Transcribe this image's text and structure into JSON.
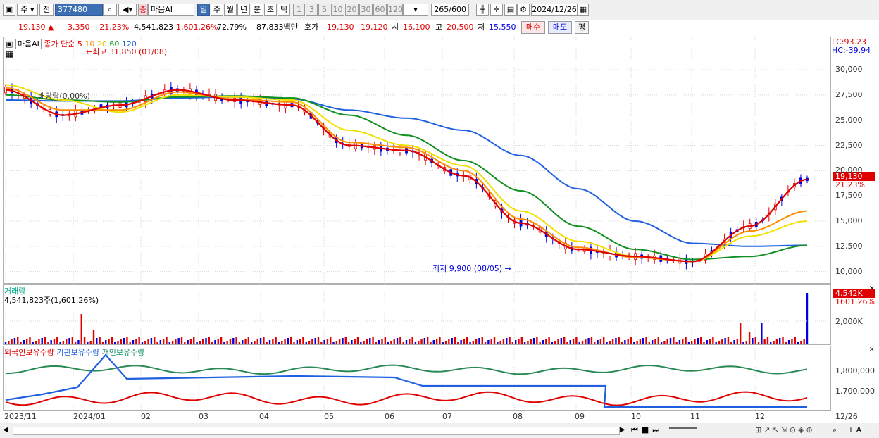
{
  "toolbar": {
    "market": "주",
    "type": "전",
    "code": "377480",
    "name": "마음AI",
    "periods": [
      "일",
      "주",
      "월",
      "년",
      "분",
      "초",
      "틱"
    ],
    "intervals": [
      "1",
      "3",
      "5",
      "10",
      "20",
      "30",
      "60",
      "120"
    ],
    "count": "265",
    "count_total": "/600",
    "date": "2024/12/26"
  },
  "info": {
    "price": "19,130 ▲",
    "change": "3,350",
    "change_pct": "+21.23%",
    "volume": "4,541,823",
    "volume_pct": "1,601.26%",
    "turnover": "72.79%",
    "amount": "87,833백만",
    "quote_label": "호가",
    "ask": "19,130",
    "bid": "19,120",
    "open_label": "시",
    "open": "16,100",
    "high_label": "고",
    "high": "20,500",
    "low_label": "저",
    "low": "15,550",
    "buy_label": "매수",
    "sell_label": "매도",
    "eval_label": "평"
  },
  "price_pane": {
    "name_tag": "마음AI",
    "ma_legend": {
      "prefix": "종가 단순",
      "periods": [
        "5",
        "10",
        "20",
        "60",
        "120"
      ]
    },
    "high_note": "←최고 31,850 (01/08)",
    "low_note": "최저 9,900 (08/05) →",
    "dividend_note": "배당락(0.00%)",
    "lc": "LC:93.23",
    "hc": "HC:-39.94",
    "current_price": "19,130",
    "current_pct": "21.23%"
  },
  "volume_pane": {
    "title": "거래량",
    "value": "4,541,823주(1,601.26%)",
    "current": "4,542K",
    "current_pct": "1601.26%",
    "tick": "2,000K"
  },
  "holding_pane": {
    "legend": [
      "외국인보유수량",
      "기관보유수량",
      "개인보유수량"
    ],
    "ticks": [
      "1,800,000",
      "1,700,000"
    ]
  },
  "x_axis": [
    "2023/11",
    "2024/01",
    "02",
    "03",
    "04",
    "05",
    "06",
    "07",
    "08",
    "09",
    "10",
    "11",
    "12",
    "12/26"
  ],
  "colors": {
    "ma5": "#e00000",
    "ma10": "#ff8c00",
    "ma20": "#f0e000",
    "ma60": "#109020",
    "ma120": "#2060e0",
    "up": "#e00000",
    "down": "#0000e0"
  },
  "chart_data": {
    "type": "line",
    "title": "",
    "y_ticks": [
      10000,
      12500,
      15000,
      17500,
      20000,
      22500,
      25000,
      27500,
      30000
    ],
    "ylim": [
      9000,
      33000
    ],
    "x": [
      "2023/11",
      "2023/12",
      "2024/01",
      "02",
      "03",
      "04",
      "05",
      "06",
      "07",
      "08",
      "09",
      "10",
      "11",
      "12",
      "12/26"
    ],
    "series": [
      {
        "name": "5",
        "values": [
          28000,
          25500,
          26500,
          28000,
          27000,
          26500,
          22500,
          22000,
          19500,
          14800,
          12200,
          11500,
          11000,
          14500,
          19130
        ]
      },
      {
        "name": "10",
        "values": [
          28200,
          26000,
          26000,
          27800,
          27100,
          26800,
          22800,
          22300,
          20000,
          15200,
          12400,
          11400,
          11000,
          14000,
          16000
        ]
      },
      {
        "name": "20",
        "values": [
          28500,
          27000,
          25800,
          27500,
          27300,
          27000,
          24000,
          22500,
          20500,
          16000,
          13000,
          11500,
          11000,
          13500,
          15000
        ]
      },
      {
        "name": "60",
        "values": [
          27500,
          27000,
          26800,
          27300,
          27400,
          27200,
          25500,
          23500,
          21000,
          18000,
          14500,
          12200,
          11200,
          11500,
          12600
        ]
      },
      {
        "name": "120",
        "values": [
          27000,
          26900,
          26900,
          27200,
          27300,
          27100,
          26000,
          25200,
          24000,
          21500,
          18200,
          15000,
          12800,
          12500,
          12600
        ]
      }
    ],
    "volume": {
      "unit": "주",
      "last": 4541823,
      "peak_days": [
        "2024/01/08",
        "2024/11/25",
        "2024/12/26"
      ]
    },
    "holding_series": [
      {
        "name": "외국인보유수량"
      },
      {
        "name": "기관보유수량"
      },
      {
        "name": "개인보유수량"
      }
    ]
  }
}
